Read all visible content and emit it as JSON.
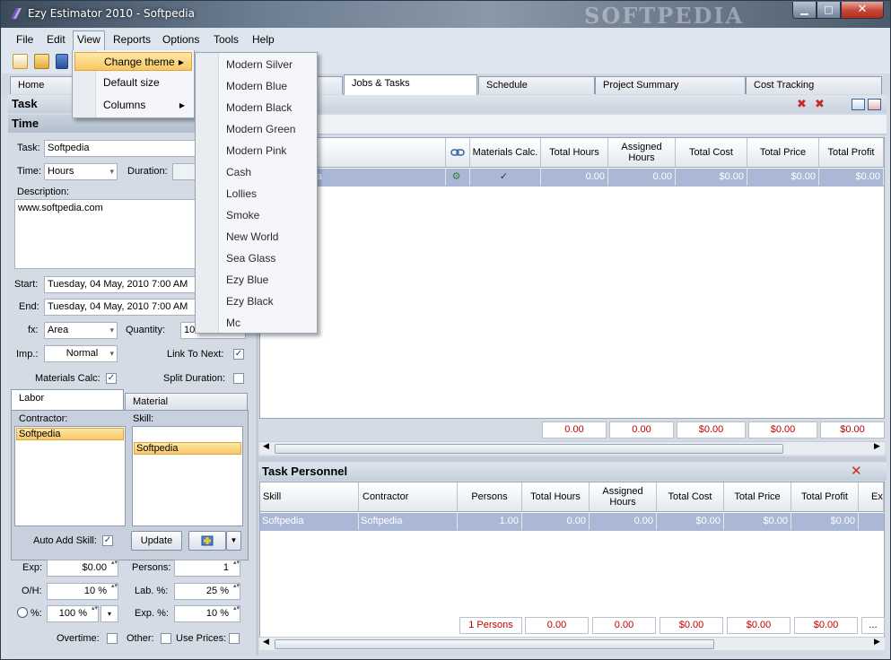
{
  "window": {
    "title": "Ezy Estimator 2010 - Softpedia",
    "watermark": "SOFTPEDIA",
    "min": "▁",
    "max": "□",
    "close": "✕"
  },
  "menubar": [
    "File",
    "Edit",
    "View",
    "Reports",
    "Options",
    "Tools",
    "Help"
  ],
  "tabs": [
    "Home",
    "Jobs & Tasks",
    "Schedule",
    "Project Summary",
    "Cost Tracking"
  ],
  "view_menu": {
    "items": [
      {
        "label": "Change theme",
        "arrow": "▶"
      },
      {
        "label": "Default size"
      },
      {
        "label": "Columns",
        "arrow": "▶"
      }
    ]
  },
  "theme_menu": [
    "Modern Silver",
    "Modern Blue",
    "Modern Black",
    "Modern Green",
    "Modern Pink",
    "Cash",
    "Lollies",
    "Smoke",
    "New World",
    "Sea Glass",
    "Ezy Blue",
    "Ezy Black",
    "Mc"
  ],
  "task_panel": {
    "header_task": "Task",
    "header_time": "Time",
    "task_label": "Task:",
    "task_value": "Softpedia",
    "time_label": "Time:",
    "time_value": "Hours",
    "duration_label": "Duration:",
    "description_label": "Description:",
    "description_value": "www.softpedia.com",
    "start_label": "Start:",
    "start_value": "Tuesday, 04 May, 2010 7:00 AM",
    "end_label": "End:",
    "end_value": "Tuesday, 04 May, 2010 7:00 AM",
    "fx_label": "fx:",
    "fx_value": "Area",
    "quantity_label": "Quantity:",
    "quantity_value": "10",
    "imp_label": "Imp.:",
    "imp_value": "Normal",
    "link_label": "Link To Next:",
    "check": "✓",
    "materials_calc_label": "Materials Calc:",
    "split_duration_label": "Split Duration:",
    "subtabs": [
      "Labor",
      "Material"
    ],
    "contractor_label": "Contractor:",
    "contractor_value": "Softpedia",
    "skill_label": "Skill:",
    "skill_value": "Softpedia",
    "auto_add_label": "Auto Add Skill:",
    "update_label": "Update",
    "exp_label": "Exp:",
    "exp_value": "$0.00",
    "persons_label": "Persons:",
    "persons_value": "1",
    "oh_label": "O/H:",
    "oh_value": "10 %",
    "lab_label": "Lab. %:",
    "lab_value": "25 %",
    "pct_label": "%:",
    "pct_value": "100 %",
    "exp_pct_label": "Exp. %:",
    "exp_pct_value": "10 %",
    "overtime_label": "Overtime:",
    "other_label": "Other:",
    "use_prices_label": "Use Prices:"
  },
  "jobs_grid": {
    "headers": [
      "Materials Calc.",
      "Total Hours",
      "Assigned Hours",
      "Total Cost",
      "Total Price",
      "Total Profit"
    ],
    "row": {
      "name": "edia",
      "check": "✓",
      "total_hours": "0.00",
      "assigned_hours": "0.00",
      "total_cost": "$0.00",
      "total_price": "$0.00",
      "total_profit": "$0.00"
    },
    "summary": [
      "0.00",
      "0.00",
      "$0.00",
      "$0.00",
      "$0.00"
    ]
  },
  "personnel": {
    "title": "Task Personnel",
    "headers": [
      "Skill",
      "Contractor",
      "Persons",
      "Total Hours",
      "Assigned Hours",
      "Total Cost",
      "Total Price",
      "Total Profit",
      "Ex"
    ],
    "row": [
      "Softpedia",
      "Softpedia",
      "1.00",
      "0.00",
      "0.00",
      "$0.00",
      "$0.00",
      "$0.00"
    ],
    "summary": [
      "1 Persons",
      "0.00",
      "0.00",
      "$0.00",
      "$0.00",
      "$0.00",
      "..."
    ]
  },
  "colors": {
    "accent": "#f8c860",
    "title_bar": "#4b5a6c",
    "negative": "#c00000"
  }
}
